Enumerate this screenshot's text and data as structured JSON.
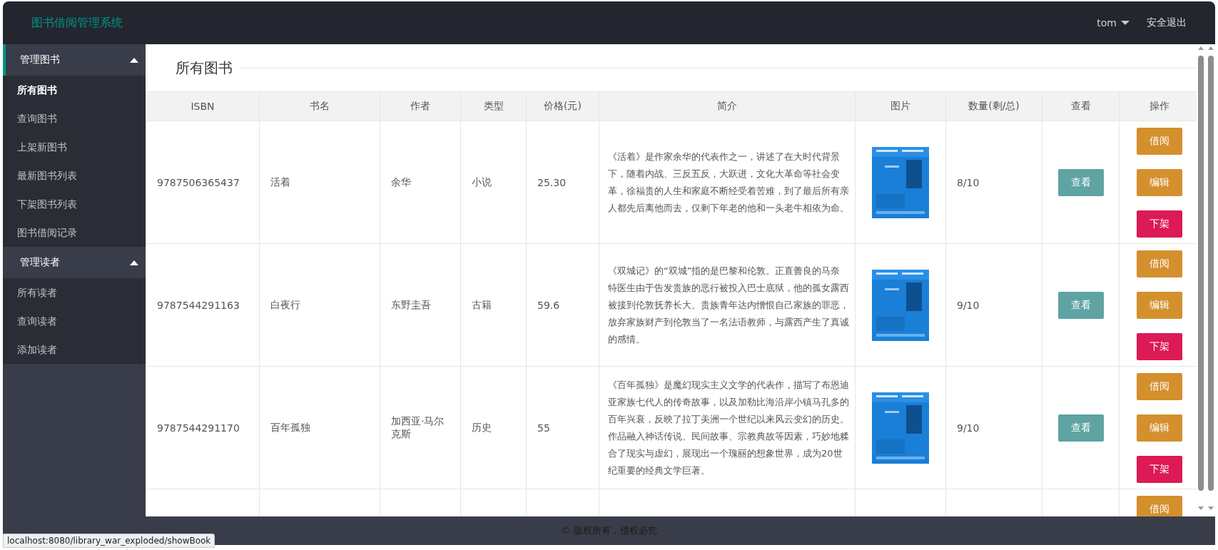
{
  "app": {
    "title": "图书借阅管理系统"
  },
  "user_menu": {
    "username": "tom",
    "logout": "安全退出"
  },
  "sidebar": {
    "groups": [
      {
        "label": "管理图书",
        "expanded": true,
        "selected": true,
        "items": [
          {
            "label": "所有图书",
            "selected": true
          },
          {
            "label": "查询图书",
            "selected": false
          },
          {
            "label": "上架新图书",
            "selected": false
          },
          {
            "label": "最新图书列表",
            "selected": false
          },
          {
            "label": "下架图书列表",
            "selected": false
          },
          {
            "label": "图书借阅记录",
            "selected": false
          }
        ]
      },
      {
        "label": "管理读者",
        "expanded": true,
        "selected": false,
        "items": [
          {
            "label": "所有读者",
            "selected": false
          },
          {
            "label": "查询读者",
            "selected": false
          },
          {
            "label": "添加读者",
            "selected": false
          }
        ]
      }
    ]
  },
  "section_title": "所有图书",
  "table": {
    "columns": [
      "ISBN",
      "书名",
      "作者",
      "类型",
      "价格(元)",
      "简介",
      "图片",
      "数量(剩/总)",
      "查看",
      "操作"
    ],
    "rows": [
      {
        "isbn": "9787506365437",
        "title": "活着",
        "author": "余华",
        "category": "小说",
        "price": "25.30",
        "summary": "《活着》是作家余华的代表作之一，讲述了在大时代背景下，随着内战、三反五反，大跃进，文化大革命等社会变革，徐福贵的人生和家庭不断经受着苦难，到了最后所有亲人都先后离他而去，仅剩下年老的他和一头老牛相依为命。",
        "cover": {
          "kind": "picture"
        },
        "quantity": "8/10",
        "view_button": "查看",
        "actions": [
          {
            "kind": "borrow",
            "label": "借阅"
          },
          {
            "kind": "edit",
            "label": "编辑"
          },
          {
            "kind": "remove",
            "label": "下架"
          }
        ]
      },
      {
        "isbn": "9787544291163",
        "title": "白夜行",
        "author": "东野圭吾",
        "category": "古籍",
        "price": "59.6",
        "summary": "《双城记》的“双城”指的是巴黎和伦敦。正直善良的马奈特医生由于告发贵族的恶行被投入巴士底狱，他的孤女露西被接到伦敦抚养长大。贵族青年达内憎恨自己家族的罪恶，放弃家族财产到伦敦当了一名法语教师，与露西产生了真诚的感情。",
        "cover": {
          "kind": "picture"
        },
        "quantity": "9/10",
        "view_button": "查看",
        "actions": [
          {
            "kind": "borrow",
            "label": "借阅"
          },
          {
            "kind": "edit",
            "label": "编辑"
          },
          {
            "kind": "remove",
            "label": "下架"
          }
        ]
      },
      {
        "isbn": "9787544291170",
        "title": "百年孤独",
        "author": "加西亚·马尔克斯",
        "category": "历史",
        "price": "55",
        "summary": "《百年孤独》是魔幻现实主义文学的代表作，描写了布恩迪亚家族七代人的传奇故事，以及加勒比海沿岸小镇马孔多的百年兴衰，反映了拉丁美洲一个世纪以来风云变幻的历史。作品融入神话传说、民间故事、宗教典故等因素，巧妙地糅合了现实与虚幻，展现出一个瑰丽的想象世界，成为20世纪重要的经典文学巨著。",
        "cover": {
          "kind": "picture"
        },
        "quantity": "9/10",
        "view_button": "查看",
        "actions": [
          {
            "kind": "borrow",
            "label": "借阅"
          },
          {
            "kind": "edit",
            "label": "编辑"
          },
          {
            "kind": "remove",
            "label": "下架"
          }
        ]
      },
      {
        "actions": [
          {
            "kind": "borrow",
            "label": "借阅"
          }
        ]
      }
    ]
  },
  "footer": "© 版权所有，侵权必究",
  "status_url": "localhost:8080/library_war_exploded/showBook"
}
